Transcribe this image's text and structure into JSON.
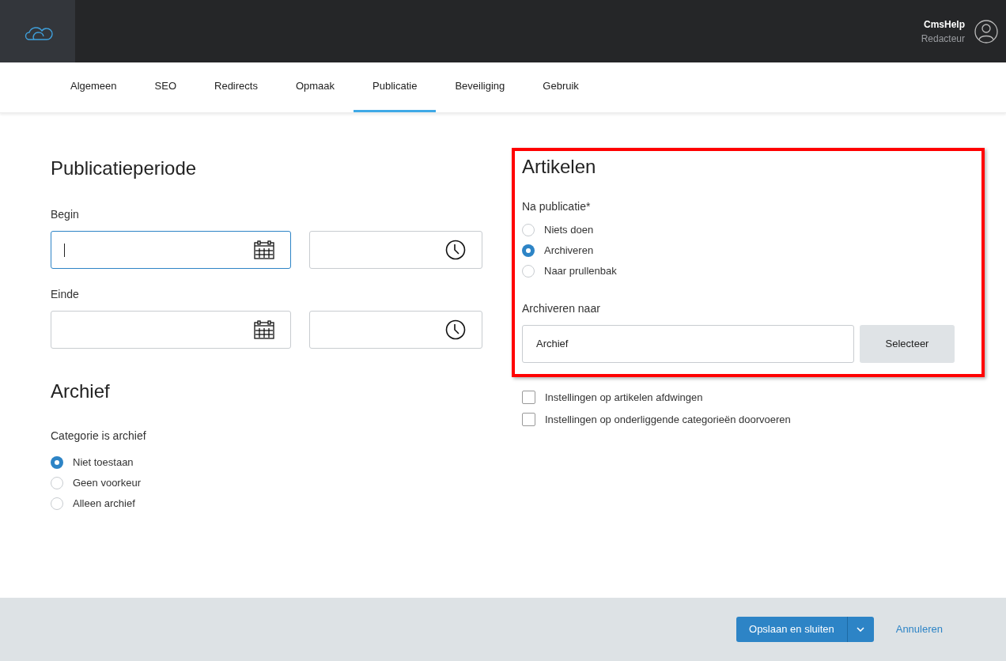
{
  "header": {
    "user_name": "CmsHelp",
    "user_role": "Redacteur"
  },
  "tabs": [
    {
      "label": "Algemeen",
      "selected": false
    },
    {
      "label": "SEO",
      "selected": false
    },
    {
      "label": "Redirects",
      "selected": false
    },
    {
      "label": "Opmaak",
      "selected": false
    },
    {
      "label": "Publicatie",
      "selected": true
    },
    {
      "label": "Beveiliging",
      "selected": false
    },
    {
      "label": "Gebruik",
      "selected": false
    }
  ],
  "publicatieperiode": {
    "title": "Publicatieperiode",
    "fields": [
      {
        "label": "Begin",
        "focused": true
      },
      {
        "label": "Einde",
        "focused": false
      }
    ]
  },
  "archief": {
    "title": "Archief",
    "label": "Categorie is archief",
    "options": [
      {
        "label": "Niet toestaan",
        "selected": true
      },
      {
        "label": "Geen voorkeur",
        "selected": false
      },
      {
        "label": "Alleen archief",
        "selected": false
      }
    ]
  },
  "artikelen": {
    "title": "Artikelen",
    "label": "Na publicatie*",
    "options": [
      {
        "label": "Niets doen",
        "selected": false
      },
      {
        "label": "Archiveren",
        "selected": true
      },
      {
        "label": "Naar prullenbak",
        "selected": false
      }
    ],
    "target_label": "Archiveren naar",
    "target_value": "Archief",
    "select_button": "Selecteer"
  },
  "checkboxes": [
    {
      "label": "Instellingen op artikelen afdwingen",
      "checked": false
    },
    {
      "label": "Instellingen op onderliggende categorieën doorvoeren",
      "checked": false
    }
  ],
  "footer": {
    "save_button": "Opslaan en sluiten",
    "cancel_link": "Annuleren"
  }
}
